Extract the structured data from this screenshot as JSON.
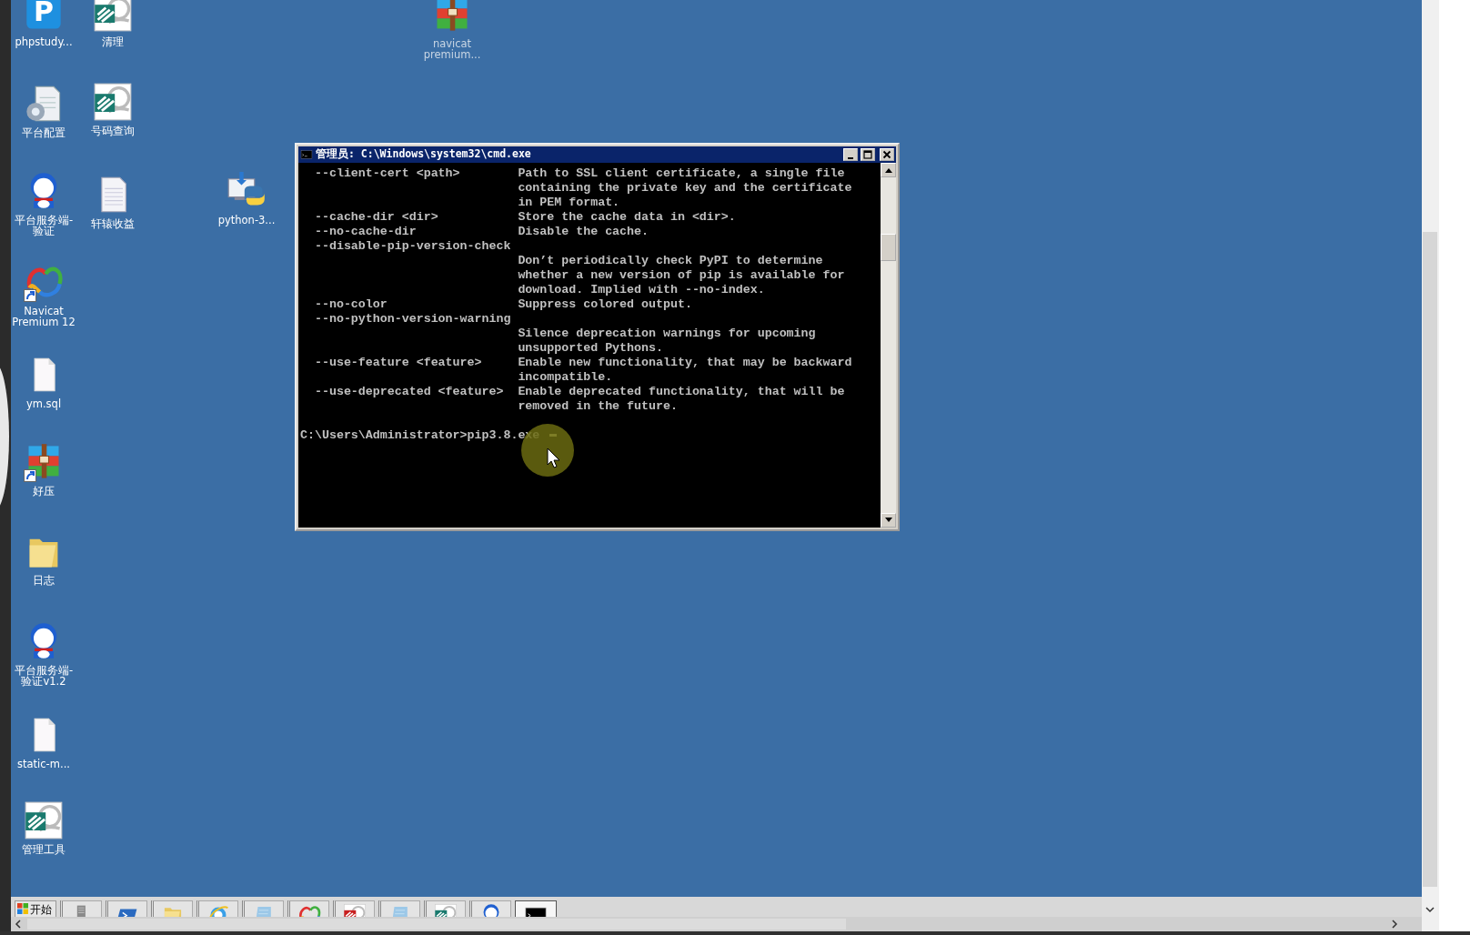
{
  "desktop": {
    "icons": [
      {
        "label": "phpstudy...",
        "kind": "phpstudy",
        "logo_text": "P"
      },
      {
        "label": "清理",
        "kind": "yi"
      },
      {
        "label": "navicat premium...",
        "kind": "archive"
      },
      {
        "label": "平台配置",
        "kind": "config"
      },
      {
        "label": "号码查询",
        "kind": "yi"
      },
      {
        "label": "平台服务端-验证",
        "kind": "mascot"
      },
      {
        "label": "轩辕收益",
        "kind": "textfile"
      },
      {
        "label": "python-3...",
        "kind": "python"
      },
      {
        "label": "Navicat Premium 12",
        "kind": "navicat",
        "shortcut": true
      },
      {
        "label": "ym.sql",
        "kind": "blank"
      },
      {
        "label": "好压",
        "kind": "archive",
        "shortcut": true
      },
      {
        "label": "日志",
        "kind": "folder"
      },
      {
        "label": "平台服务端-验证v1.2",
        "kind": "mascot"
      },
      {
        "label": "static-m...",
        "kind": "blank"
      },
      {
        "label": "管理工具",
        "kind": "yi"
      }
    ]
  },
  "console": {
    "title": "管理员: C:\\Windows\\system32\\cmd.exe",
    "lines": [
      "  --client-cert <path>        Path to SSL client certificate, a single file",
      "                              containing the private key and the certificate",
      "                              in PEM format.",
      "  --cache-dir <dir>           Store the cache data in <dir>.",
      "  --no-cache-dir              Disable the cache.",
      "  --disable-pip-version-check",
      "                              Don’t periodically check PyPI to determine",
      "                              whether a new version of pip is available for",
      "                              download. Implied with --no-index.",
      "  --no-color                  Suppress colored output.",
      "  --no-python-version-warning",
      "                              Silence deprecation warnings for upcoming",
      "                              unsupported Pythons.",
      "  --use-feature <feature>     Enable new functionality, that may be backward",
      "                              incompatible.",
      "  --use-deprecated <feature>  Enable deprecated functionality, that will be",
      "                              removed in the future."
    ],
    "prompt": "C:\\Users\\Administrator>pip3.8.exe"
  },
  "taskbar": {
    "start_label": "开始",
    "buttons": [
      {
        "kind": "server",
        "selected": false
      },
      {
        "kind": "powershell",
        "selected": false
      },
      {
        "kind": "folder",
        "selected": false
      },
      {
        "kind": "browser",
        "selected": false
      },
      {
        "kind": "notepad",
        "selected": false
      },
      {
        "kind": "navicat",
        "selected": false
      },
      {
        "kind": "yired",
        "selected": false
      },
      {
        "kind": "notepad",
        "selected": false
      },
      {
        "kind": "yi",
        "selected": false
      },
      {
        "kind": "mascot",
        "selected": false
      },
      {
        "kind": "console",
        "selected": true
      }
    ]
  }
}
